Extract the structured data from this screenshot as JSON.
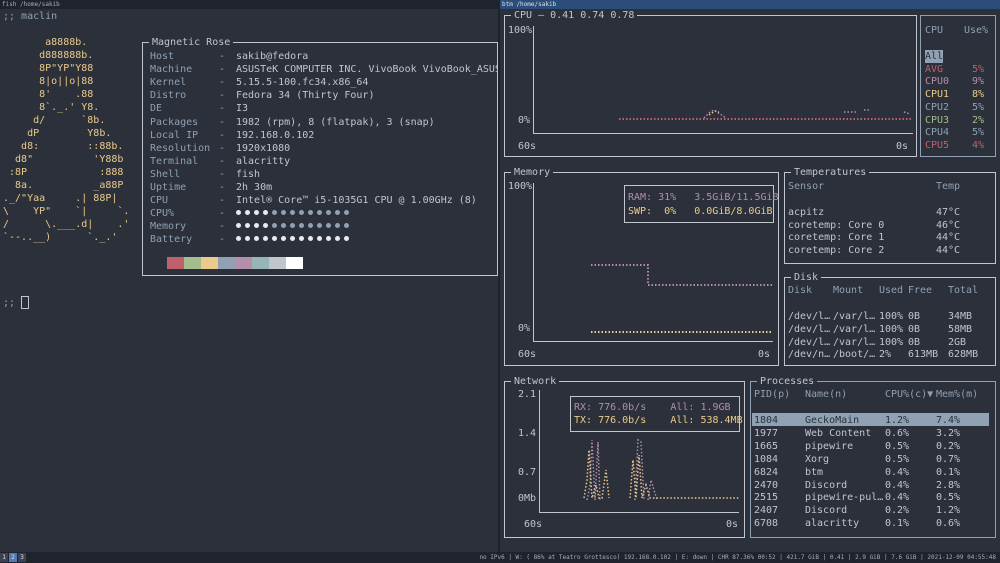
{
  "left_pane": {
    "title": "fish /home/sakib",
    "prompt1": ";; maclin",
    "prompt2": ";;",
    "ascii_logo": [
      "       a8888b.",
      "      d888888b.",
      "      8P\"YP\"Y88",
      "      8|o||o|88",
      "      8'    .88",
      "      8`._.' Y8.",
      "     d/      `8b.",
      "    dP        Y8b.",
      "   d8:        ::88b.",
      "  d8\"          'Y88b",
      " :8P            :888",
      "  8a.          _a88P",
      "._/\"Yaa     .| 88P|",
      "\\    YP\"    `|     `.",
      "/      \\.___.d|    .'",
      "`--..__)      `._.'"
    ],
    "info_title": "Magnetic Rose",
    "info": [
      {
        "key": "Host",
        "value": "sakib@fedora"
      },
      {
        "key": "Machine",
        "value": "ASUSTeK COMPUTER INC. VivoBook VivoBook_ASUSL"
      },
      {
        "key": "Kernel",
        "value": "5.15.5-100.fc34.x86_64"
      },
      {
        "key": "Distro",
        "value": "Fedora 34 (Thirty Four)"
      },
      {
        "key": "DE",
        "value": "I3"
      },
      {
        "key": "Packages",
        "value": "1982 (rpm), 8 (flatpak), 3 (snap)"
      },
      {
        "key": "Local IP",
        "value": "192.168.0.102"
      },
      {
        "key": "Resolution",
        "value": "1920x1080"
      },
      {
        "key": "Terminal",
        "value": "alacritty"
      },
      {
        "key": "Shell",
        "value": "fish"
      },
      {
        "key": "Uptime",
        "value": "2h 30m"
      },
      {
        "key": "CPU",
        "value": "Intel® Core™ i5-1035G1 CPU @ 1.00GHz (8)"
      }
    ],
    "info_sep": "-",
    "bars": [
      {
        "key": "CPU%",
        "level": 0.3
      },
      {
        "key": "Memory",
        "level": 0.3
      },
      {
        "key": "Battery",
        "level": 1.0
      }
    ],
    "palette": [
      "#2b303b",
      "#bf616a",
      "#a3be8c",
      "#ebcb8b",
      "#8fa1b3",
      "#b48ead",
      "#96b5b4",
      "#c0c5ce",
      "#ffffff"
    ]
  },
  "right_pane": {
    "title": "btm /home/sakib",
    "cpu": {
      "title": "CPU — 0.41 0.74 0.78",
      "y_top": "100%",
      "y_bottom": "0%",
      "x_left": "60s",
      "x_right": "0s",
      "table_head": [
        "CPU",
        "Use%"
      ],
      "rows": [
        {
          "name": "All",
          "use": "",
          "color": "#8fa1b3"
        },
        {
          "name": "AVG",
          "use": "5%",
          "color": "#bf616a"
        },
        {
          "name": "CPU0",
          "use": "9%",
          "color": "#b48ead"
        },
        {
          "name": "CPU1",
          "use": "8%",
          "color": "#ebcb8b"
        },
        {
          "name": "CPU2",
          "use": "5%",
          "color": "#8fa1b3"
        },
        {
          "name": "CPU3",
          "use": "2%",
          "color": "#a3be8c"
        },
        {
          "name": "CPU4",
          "use": "5%",
          "color": "#8fa1b3"
        },
        {
          "name": "CPU5",
          "use": "4%",
          "color": "#bf616a"
        }
      ]
    },
    "memory": {
      "title": "Memory",
      "y_top": "100%",
      "y_bottom": "0%",
      "x_left": "60s",
      "x_right": "0s",
      "ram_label": "RAM: 31%",
      "ram_value": "3.5GiB/11.5GiB",
      "swp_label": "SWP:  0%",
      "swp_value": "0.0GiB/8.0GiB",
      "ram_color": "#b48ead",
      "swp_color": "#ebcb8b"
    },
    "temperatures": {
      "title": "Temperatures",
      "head": [
        "Sensor",
        "Temp"
      ],
      "rows": [
        {
          "sensor": "acpitz",
          "temp": "47°C"
        },
        {
          "sensor": "coretemp: Core 0",
          "temp": "46°C"
        },
        {
          "sensor": "coretemp: Core 1",
          "temp": "44°C"
        },
        {
          "sensor": "coretemp: Core 2",
          "temp": "44°C"
        }
      ]
    },
    "disk": {
      "title": "Disk",
      "head": [
        "Disk",
        "Mount",
        "Used",
        "Free",
        "Total"
      ],
      "rows": [
        {
          "disk": "/dev/l…",
          "mount": "/var/l…",
          "used": "100%",
          "free": "0B",
          "total": "34MB"
        },
        {
          "disk": "/dev/l…",
          "mount": "/var/l…",
          "used": "100%",
          "free": "0B",
          "total": "58MB"
        },
        {
          "disk": "/dev/l…",
          "mount": "/var/l…",
          "used": "100%",
          "free": "0B",
          "total": "2GB"
        },
        {
          "disk": "/dev/n…",
          "mount": "/boot/…",
          "used": "2%",
          "free": "613MB",
          "total": "628MB"
        }
      ]
    },
    "network": {
      "title": "Network",
      "y_labels": [
        "2.1",
        "1.4",
        "0.7",
        "0Mb"
      ],
      "x_left": "60s",
      "x_right": "0s",
      "rx_label": "RX: 776.0b/s",
      "rx_all": "All: 1.9GB",
      "tx_label": "TX: 776.0b/s",
      "tx_all": "All: 538.4MB",
      "rx_color": "#b48ead",
      "tx_color": "#ebcb8b"
    },
    "processes": {
      "title": "Processes",
      "head": [
        "PID(p)",
        "Name(n)",
        "CPU%(c)▼",
        "Mem%(m)"
      ],
      "rows": [
        {
          "pid": "1804",
          "name": "GeckoMain",
          "cpu": "1.2%",
          "mem": "7.4%"
        },
        {
          "pid": "1977",
          "name": "Web Content",
          "cpu": "0.6%",
          "mem": "3.2%"
        },
        {
          "pid": "1665",
          "name": "pipewire",
          "cpu": "0.5%",
          "mem": "0.2%"
        },
        {
          "pid": "1084",
          "name": "Xorg",
          "cpu": "0.5%",
          "mem": "0.7%"
        },
        {
          "pid": "6824",
          "name": "btm",
          "cpu": "0.4%",
          "mem": "0.1%"
        },
        {
          "pid": "2470",
          "name": "Discord",
          "cpu": "0.4%",
          "mem": "2.8%"
        },
        {
          "pid": "2515",
          "name": "pipewire-pul…",
          "cpu": "0.4%",
          "mem": "0.5%"
        },
        {
          "pid": "2407",
          "name": "Discord",
          "cpu": "0.2%",
          "mem": "1.2%"
        },
        {
          "pid": "6708",
          "name": "alacritty",
          "cpu": "0.1%",
          "mem": "0.6%"
        }
      ]
    }
  },
  "statusbar": {
    "workspaces": [
      "1",
      "2",
      "3"
    ],
    "active_workspace": 1,
    "right_text": "no IPv6 | W: ( 86% at Teatro Grottesco) 192.168.0.102 | E: down | CHR 87.36% 00:52 | 421.7 GiB | 0.41 | 2.9 GiB | 7.6 GiB | 2021-12-09 04:55:48"
  }
}
